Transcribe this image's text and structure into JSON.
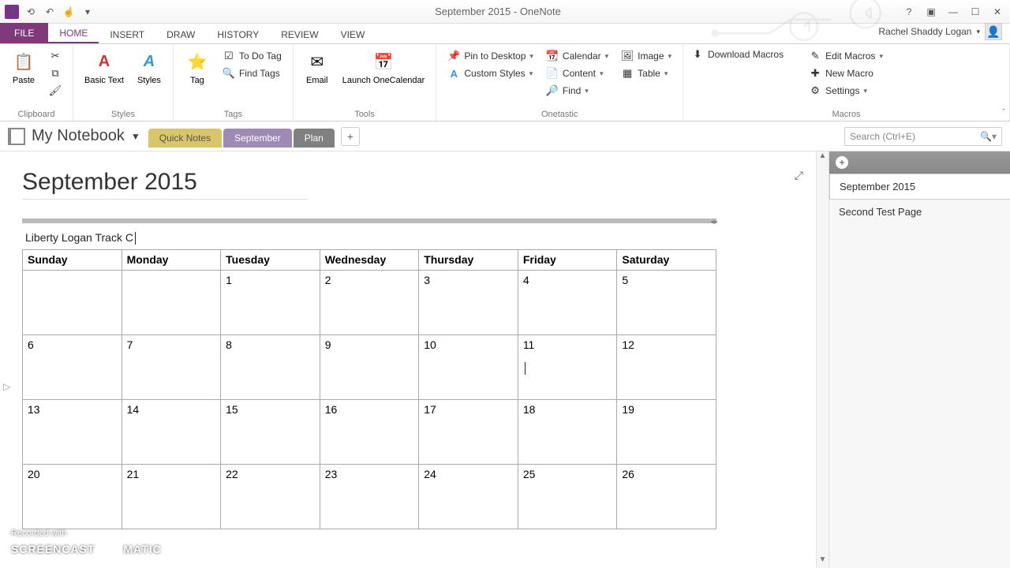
{
  "window": {
    "title": "September 2015 - OneNote"
  },
  "user_name": "Rachel Shaddy Logan",
  "ribbon_tabs": {
    "file": "FILE",
    "home": "HOME",
    "insert": "INSERT",
    "draw": "DRAW",
    "history": "HISTORY",
    "review": "REVIEW",
    "view": "VIEW"
  },
  "ribbon": {
    "clipboard": {
      "paste": "Paste",
      "label": "Clipboard"
    },
    "styles": {
      "basic": "Basic Text",
      "styles": "Styles",
      "label": "Styles"
    },
    "tags": {
      "tag": "Tag",
      "todo": "To Do Tag",
      "find": "Find Tags",
      "label": "Tags"
    },
    "tools": {
      "email": "Email",
      "launch": "Launch OneCalendar",
      "label": "Tools"
    },
    "onetastic": {
      "pin": "Pin to Desktop",
      "custom": "Custom Styles",
      "calendar": "Calendar",
      "content": "Content",
      "find": "Find",
      "image": "Image",
      "table": "Table",
      "label": "Onetastic"
    },
    "macros": {
      "download": "Download Macros",
      "edit": "Edit Macros",
      "new": "New Macro",
      "settings": "Settings",
      "label": "Macros"
    }
  },
  "notebook": {
    "name": "My Notebook"
  },
  "sections": {
    "a": "Quick Notes",
    "b": "September",
    "c": "Plan"
  },
  "search": {
    "placeholder": "Search (Ctrl+E)"
  },
  "page": {
    "title": "September 2015",
    "caption": "Liberty Logan Track C",
    "days": [
      "Sunday",
      "Monday",
      "Tuesday",
      "Wednesday",
      "Thursday",
      "Friday",
      "Saturday"
    ],
    "rows": [
      [
        "",
        "",
        "1",
        "2",
        "3",
        "4",
        "5"
      ],
      [
        "6",
        "7",
        "8",
        "9",
        "10",
        "11",
        "12"
      ],
      [
        "13",
        "14",
        "15",
        "16",
        "17",
        "18",
        "19"
      ],
      [
        "20",
        "21",
        "22",
        "23",
        "24",
        "25",
        "26"
      ]
    ]
  },
  "pagelist": {
    "p0": "September 2015",
    "p1": "Second Test Page"
  },
  "footer": {
    "rec": "Recorded with",
    "brand": "SCREENCAST",
    "brand2": "MATIC"
  }
}
